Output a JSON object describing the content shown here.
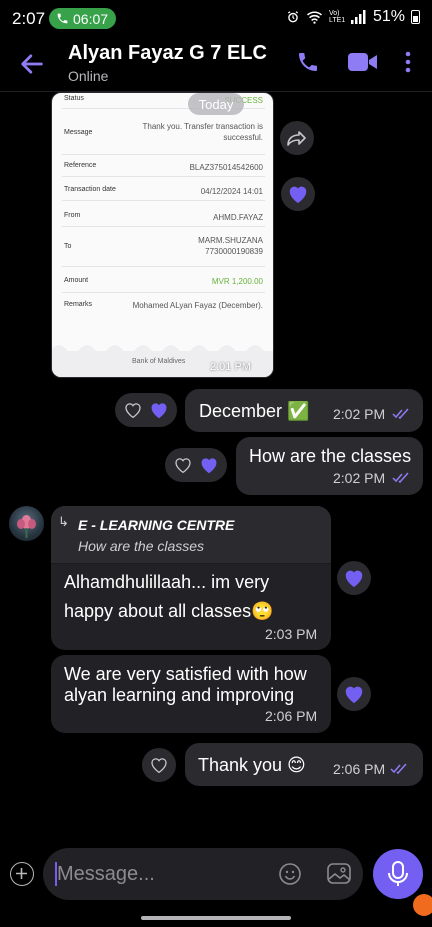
{
  "status_bar": {
    "time": "2:07",
    "call_time": "06:07",
    "net_label": "Vo) LTE1",
    "battery": "51%"
  },
  "header": {
    "contact_name": "Alyan Fayaz G 7 ELC",
    "status": "Online"
  },
  "date_chip": "Today",
  "receipt": {
    "rows": [
      {
        "label": "Status",
        "value": "SUCCESS"
      },
      {
        "label": "Message",
        "value": "Thank you. Transfer transaction is successful."
      },
      {
        "label": "Reference",
        "value": "BLAZ375014542600"
      },
      {
        "label": "Transaction date",
        "value": "04/12/2024 14:01"
      },
      {
        "label": "From",
        "value": "AHMD.FAYAZ"
      },
      {
        "label": "To",
        "value": "MARM.SHUZANA 7730000190839"
      },
      {
        "label": "Amount",
        "value": "MVR 1,200.00"
      },
      {
        "label": "Remarks",
        "value": "Mohamed ALyan Fayaz (December)."
      }
    ],
    "bank": "Bank of Maldives",
    "time": "2:01 PM"
  },
  "messages": [
    {
      "text": "December ✅",
      "time": "2:02 PM",
      "direction": "out"
    },
    {
      "text": "How are the classes",
      "time": "2:02 PM",
      "direction": "out"
    },
    {
      "quote_name": "E - LEARNING CENTRE",
      "quote_text": "How are the classes",
      "line1": "Alhamdhulillaah... im very",
      "line2": "happy about all classes🙄",
      "time": "2:03 PM",
      "direction": "in"
    },
    {
      "line1": "We are very satisfied with how",
      "line2": "alyan learning and improving",
      "time": "2:06 PM",
      "direction": "in"
    },
    {
      "text": "Thank you 😊",
      "time": "2:06 PM",
      "direction": "out"
    }
  ],
  "composer": {
    "placeholder": "Message..."
  },
  "colors": {
    "accent": "#7360f2",
    "bubble": "#2b2b2f",
    "background": "#000000",
    "call_pill": "#37a24a"
  }
}
